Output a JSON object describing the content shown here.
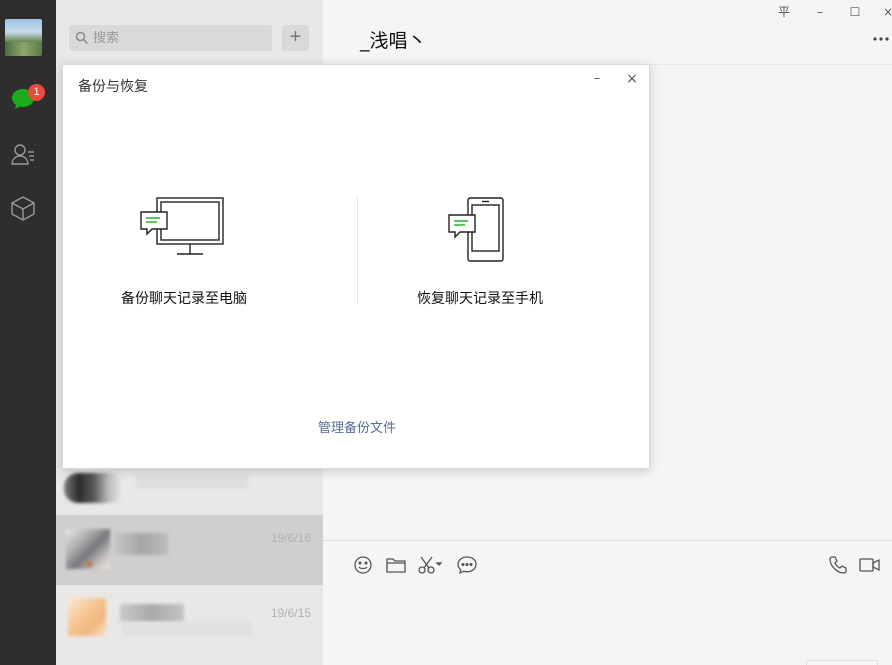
{
  "window": {
    "chat_title": "_浅唱丶",
    "controls": {
      "pin": "平",
      "minimize": "–",
      "maximize": "☐",
      "close": "×"
    }
  },
  "nav": {
    "unread_badge": "1",
    "icons": [
      "chat-icon",
      "contacts-icon",
      "favorites-icon"
    ]
  },
  "search": {
    "placeholder": "搜索"
  },
  "add_button": "+",
  "chat_list": [
    {
      "time": ""
    },
    {
      "time": "19/6/16",
      "selected": true
    },
    {
      "time": "19/6/15"
    }
  ],
  "dialog": {
    "title": "备份与恢复",
    "minimize": "–",
    "close": "×",
    "options": [
      {
        "label": "备份聊天记录至电脑",
        "icon": "monitor-chat-icon"
      },
      {
        "label": "恢复聊天记录至手机",
        "icon": "phone-chat-icon"
      }
    ],
    "manage_link": "管理备份文件"
  },
  "colors": {
    "sidebar": "#2e2e2e",
    "list": "#eae8e7",
    "link": "#576b95",
    "badge": "#e74c3c",
    "accent": "#1aad19"
  }
}
